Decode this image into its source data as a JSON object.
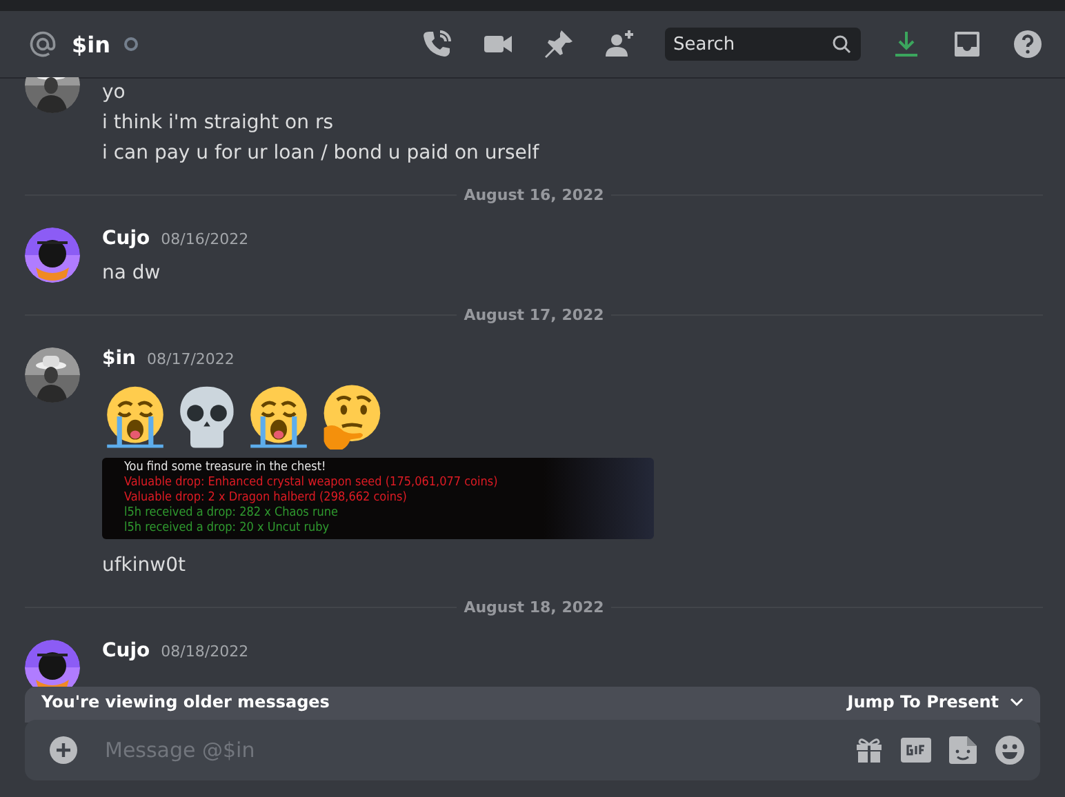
{
  "header": {
    "name": "$in",
    "online": false,
    "search": {
      "placeholder": "Search"
    }
  },
  "messages": [
    {
      "kind": "tail",
      "avatar": {
        "kind": "photo"
      },
      "lines": [
        "yo",
        "i think i'm straight on rs",
        "i can pay u for ur loan / bond u paid on urself"
      ]
    },
    {
      "kind": "divider",
      "label": "August 16, 2022"
    },
    {
      "kind": "message",
      "avatar": {
        "kind": "cartoon"
      },
      "author": "Cujo",
      "time": "08/16/2022",
      "lines": [
        "na dw"
      ]
    },
    {
      "kind": "divider",
      "label": "August 17, 2022"
    },
    {
      "kind": "message",
      "avatar": {
        "kind": "photo"
      },
      "author": "$in",
      "time": "08/17/2022",
      "emojis": [
        {
          "kind": "crying"
        },
        {
          "kind": "skull"
        },
        {
          "kind": "crying"
        },
        {
          "kind": "thinking"
        }
      ],
      "attachment": {
        "lines": [
          {
            "text": "You find some treasure in the chest!",
            "color": "#e8e8e8"
          },
          {
            "text": "Valuable drop: Enhanced crystal weapon seed (175,061,077 coins)",
            "color": "#e01b24"
          },
          {
            "text": "Valuable drop: 2 x Dragon halberd (298,662 coins)",
            "color": "#e01b24"
          },
          {
            "text": "l5h received a drop: 282 x Chaos rune",
            "color": "#2f9a2f"
          },
          {
            "text": "l5h received a drop: 20 x Uncut ruby",
            "color": "#2f9a2f"
          }
        ]
      },
      "lines": [
        "ufkinw0t"
      ]
    },
    {
      "kind": "divider",
      "label": "August 18, 2022"
    },
    {
      "kind": "message",
      "avatar": {
        "kind": "cartoon"
      },
      "author": "Cujo",
      "time": "08/18/2022"
    }
  ],
  "banner": {
    "text": "You're viewing older messages",
    "action": "Jump To Present"
  },
  "composer": {
    "placeholder": "Message @$in"
  }
}
